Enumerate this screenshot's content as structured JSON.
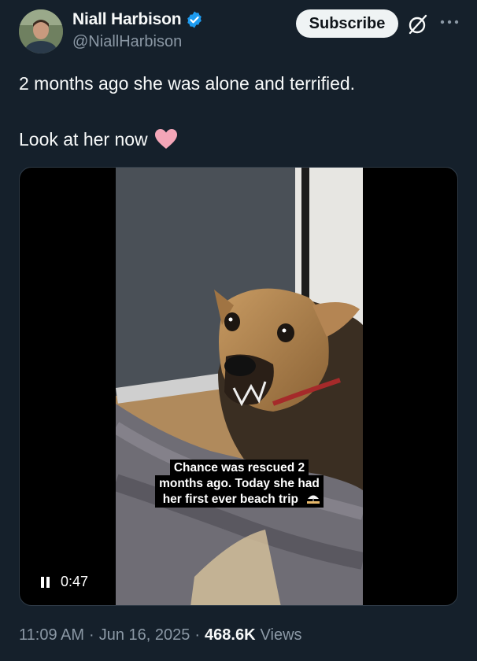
{
  "author": {
    "name": "Niall Harbison",
    "handle": "@NiallHarbison"
  },
  "actions": {
    "subscribe_label": "Subscribe"
  },
  "post": {
    "line1": "2 months ago she was alone and terrified.",
    "line2": "Look at her now"
  },
  "video": {
    "caption_line1": "Chance was rescued 2",
    "caption_line2": "months ago. Today she had",
    "caption_line3": "her first ever beach trip",
    "elapsed": "0:47"
  },
  "meta": {
    "time": "11:09 AM",
    "date": "Jun 16, 2025",
    "views_count": "468.6K",
    "views_label": "Views"
  },
  "icons": {
    "verified": "verified-badge-icon",
    "grok": "grok-icon",
    "more": "more-icon",
    "heart": "pink-heart-icon",
    "pause": "pause-icon",
    "beach": "beach-umbrella-icon"
  },
  "colors": {
    "background": "#15202b",
    "text": "#f7f9f9",
    "muted": "#8b98a5",
    "verified": "#1d9bf0",
    "heart": "#f4a6b8"
  }
}
